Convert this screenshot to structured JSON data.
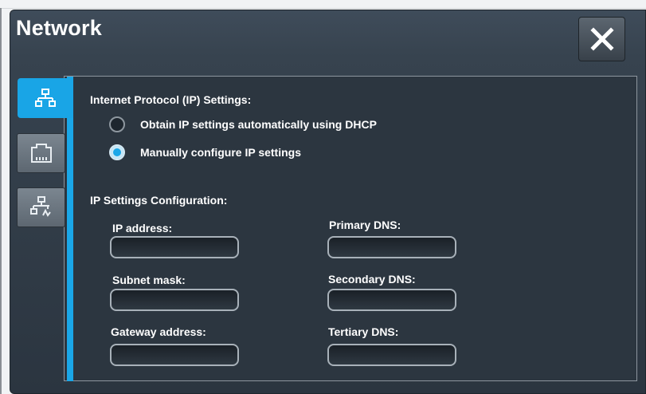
{
  "window": {
    "title": "Network",
    "close_icon": "close-icon"
  },
  "tabs": [
    {
      "icon": "network-icon",
      "active": true
    },
    {
      "icon": "ethernet-port-icon",
      "active": false
    },
    {
      "icon": "network-settings-icon",
      "active": false
    }
  ],
  "ip_settings": {
    "section_title": "Internet Protocol (IP) Settings:",
    "options": [
      {
        "label": "Obtain IP settings automatically using DHCP",
        "selected": false
      },
      {
        "label": "Manually configure IP settings",
        "selected": true
      }
    ]
  },
  "config": {
    "section_title": "IP Settings Configuration:",
    "ip_address": {
      "label": "IP address:",
      "value": ""
    },
    "subnet_mask": {
      "label": "Subnet mask:",
      "value": ""
    },
    "gateway_address": {
      "label": "Gateway address:",
      "value": ""
    },
    "primary_dns": {
      "label": "Primary DNS:",
      "value": ""
    },
    "secondary_dns": {
      "label": "Secondary DNS:",
      "value": ""
    },
    "tertiary_dns": {
      "label": "Tertiary DNS:",
      "value": ""
    }
  },
  "colors": {
    "accent": "#1aa7e8",
    "dialog_bg": "#2c3640",
    "title_bar": "#3f4c5a",
    "text": "#ffffff"
  }
}
